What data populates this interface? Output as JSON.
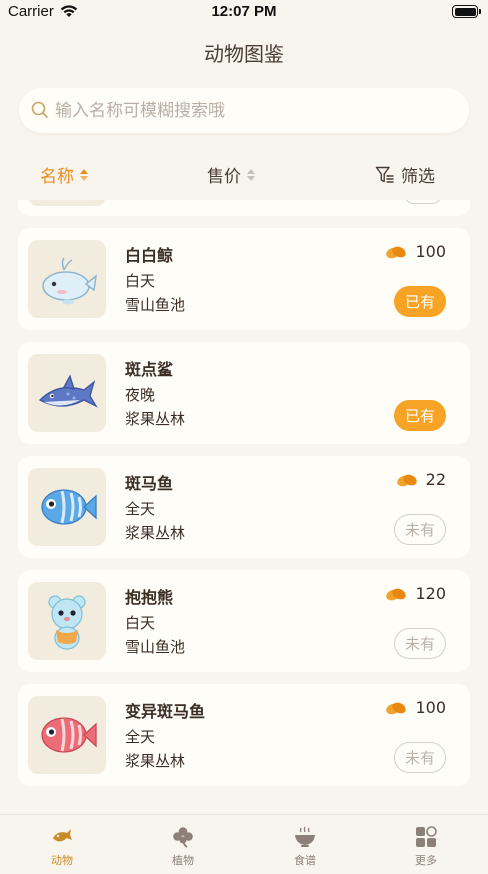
{
  "status_bar": {
    "carrier": "Carrier",
    "time": "12:07 PM"
  },
  "nav": {
    "title": "动物图鉴"
  },
  "search": {
    "placeholder": "输入名称可模糊搜索哦",
    "value": ""
  },
  "sort": {
    "name_label": "名称",
    "price_label": "售价",
    "filter_label": "筛选",
    "active_sort": "名称 ascending"
  },
  "animals": [
    {
      "name": "白白鲸",
      "time": "白天",
      "place": "雪山鱼池",
      "price": "100",
      "status": "已有"
    },
    {
      "name": "斑点鲨",
      "time": "夜晚",
      "place": "浆果丛林",
      "price": "",
      "status": "已有"
    },
    {
      "name": "斑马鱼",
      "time": "全天",
      "place": "浆果丛林",
      "price": "22",
      "status": "未有"
    },
    {
      "name": "抱抱熊",
      "time": "白天",
      "place": "雪山鱼池",
      "price": "120",
      "status": "未有"
    },
    {
      "name": "变异斑马鱼",
      "time": "全天",
      "place": "浆果丛林",
      "price": "100",
      "status": "未有"
    }
  ],
  "icons": {
    "price": "bean-coin-icon",
    "animals": [
      "beluga-icon",
      "shark-icon",
      "striped-fish-icon",
      "bear-icon",
      "red-fish-icon"
    ]
  },
  "tabs": [
    {
      "label": "动物",
      "icon": "fish-icon",
      "active": true
    },
    {
      "label": "植物",
      "icon": "clover-icon",
      "active": false
    },
    {
      "label": "食谱",
      "icon": "bowl-icon",
      "active": false
    },
    {
      "label": "更多",
      "icon": "grid-icon",
      "active": false
    }
  ],
  "colors": {
    "accent": "#ec8b1c",
    "owned_badge": "#f7a325",
    "background": "#f8f5ee",
    "card": "#fffdf8"
  }
}
